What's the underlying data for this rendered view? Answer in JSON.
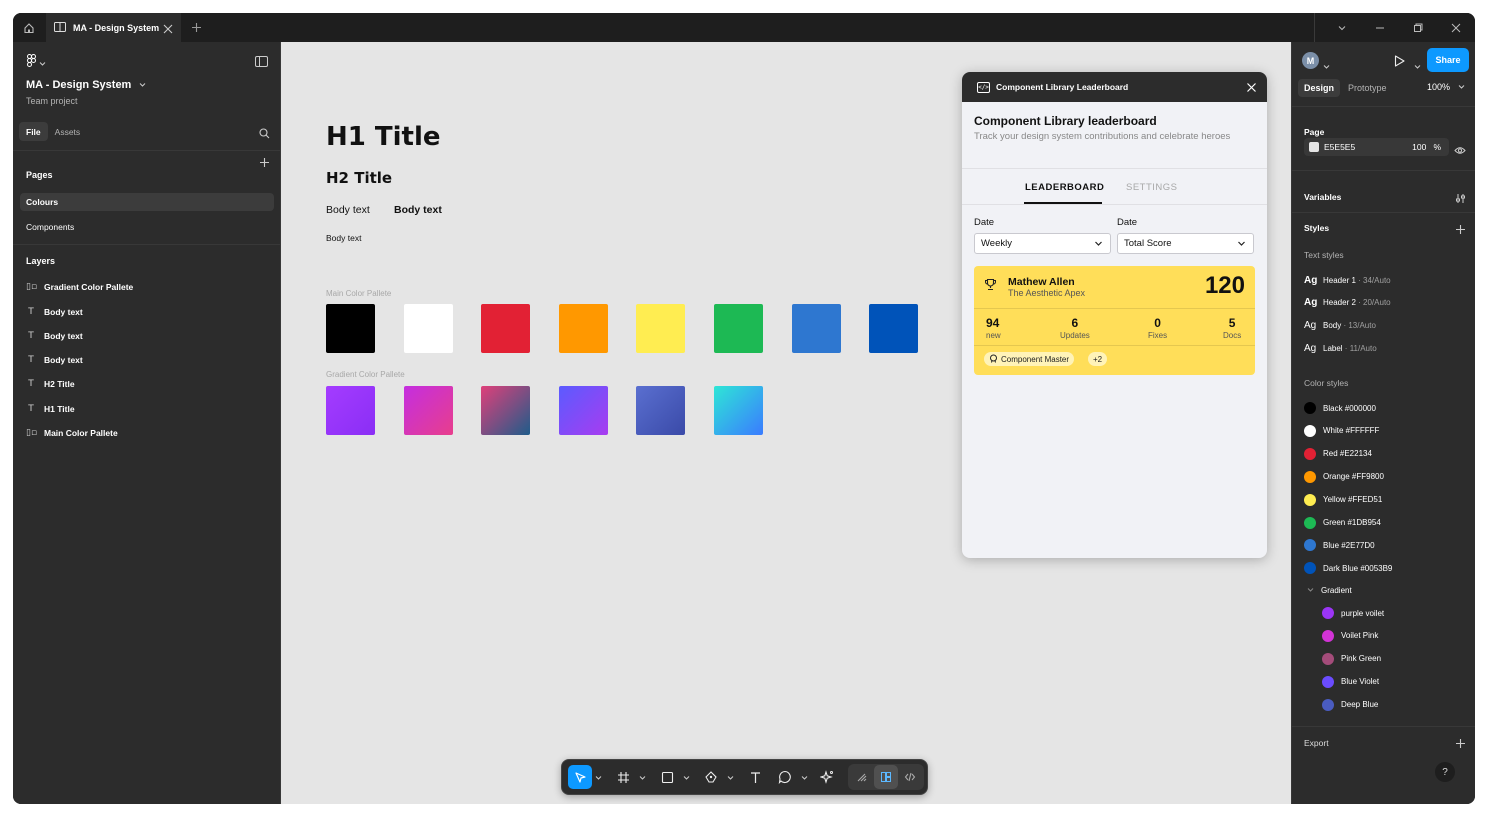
{
  "tab": {
    "title": "MA - Design System"
  },
  "file": {
    "title": "MA - Design System",
    "subtitle": "Team project",
    "tabs": [
      "File",
      "Assets"
    ]
  },
  "pages": {
    "heading": "Pages",
    "items": [
      {
        "label": "Colours",
        "active": true
      },
      {
        "label": "Components",
        "active": false
      }
    ]
  },
  "layers": {
    "heading": "Layers",
    "items": [
      {
        "icon": "frame-icon",
        "label": "Gradient Color Pallete"
      },
      {
        "icon": "text-icon",
        "label": "Body text"
      },
      {
        "icon": "text-icon",
        "label": "Body text"
      },
      {
        "icon": "text-icon",
        "label": "Body text"
      },
      {
        "icon": "text-icon",
        "label": "H2 Title"
      },
      {
        "icon": "text-icon",
        "label": "H1 Title"
      },
      {
        "icon": "frame-icon",
        "label": "Main Color Pallete"
      }
    ]
  },
  "canvas": {
    "h1": "H1 Title",
    "h2": "H2 Title",
    "body1": "Body text",
    "body2": "Body text",
    "body3": "Body text",
    "main_palette_label": "Main Color Pallete",
    "gradient_palette_label": "Gradient Color Pallete",
    "main_colors": [
      "#000000",
      "#FFFFFF",
      "#E22134",
      "#FF9800",
      "#FFED51",
      "#1DB954",
      "#2E77D0",
      "#0053B9"
    ],
    "gradients": [
      [
        "#a43cff",
        "#8a2ef5"
      ],
      [
        "#c42ee0",
        "#e83e8c"
      ],
      [
        "#e0407a",
        "#1f5c8a"
      ],
      [
        "#5b5bff",
        "#a83cf0"
      ],
      [
        "#5a6fd0",
        "#3a4aa8"
      ],
      [
        "#2ee6d6",
        "#3a7bff"
      ]
    ]
  },
  "plugin": {
    "window_title": "Component Library Leaderboard",
    "title": "Component Library leaderboard",
    "subtitle": "Track your design system contributions and celebrate heroes",
    "tabs": [
      "LEADERBOARD",
      "SETTINGS"
    ],
    "filters": [
      {
        "label": "Date",
        "value": "Weekly"
      },
      {
        "label": "Date",
        "value": "Total Score"
      }
    ],
    "card": {
      "name": "Mathew Allen",
      "team": "The Aesthetic Apex",
      "score": "120",
      "stats": [
        {
          "value": "94",
          "label": "new"
        },
        {
          "value": "6",
          "label": "Updates"
        },
        {
          "value": "0",
          "label": "Fixes"
        },
        {
          "value": "5",
          "label": "Docs"
        }
      ],
      "badge": "Component Master",
      "more": "+2"
    }
  },
  "right": {
    "avatar": "M",
    "share": "Share",
    "tabs": [
      "Design",
      "Prototype"
    ],
    "zoom": "100%",
    "page_heading": "Page",
    "page_fill": "E5E5E5",
    "page_opacity": "100",
    "page_pct": "%",
    "variables": "Variables",
    "styles": "Styles",
    "text_styles_heading": "Text styles",
    "text_styles": [
      {
        "ag": "Ag",
        "name": "Header 1",
        "meta": " · 34/Auto"
      },
      {
        "ag": "Ag",
        "name": "Header 2",
        "meta": " · 20/Auto"
      },
      {
        "ag": "Ag",
        "name": "Body",
        "meta": " · 13/Auto"
      },
      {
        "ag": "Ag",
        "name": "Label",
        "meta": " · 11/Auto"
      }
    ],
    "color_styles_heading": "Color styles",
    "color_styles": [
      {
        "name": "Black #000000",
        "color": "#000000"
      },
      {
        "name": "White #FFFFFF",
        "color": "#FFFFFF"
      },
      {
        "name": "Red #E22134",
        "color": "#E22134"
      },
      {
        "name": "Orange #FF9800",
        "color": "#FF9800"
      },
      {
        "name": "Yellow #FFED51",
        "color": "#FFED51"
      },
      {
        "name": "Green #1DB954",
        "color": "#1DB954"
      },
      {
        "name": "Blue #2E77D0",
        "color": "#2E77D0"
      },
      {
        "name": "Dark Blue #0053B9",
        "color": "#0053B9"
      }
    ],
    "gradient_group": "Gradient",
    "gradient_styles": [
      {
        "name": "purple voilet",
        "color": "#9b35f5"
      },
      {
        "name": "Voilet Pink",
        "color": "#d233d6"
      },
      {
        "name": "Pink Green",
        "color": "#a44c7a"
      },
      {
        "name": "Blue Violet",
        "color": "#6b4cff"
      },
      {
        "name": "Deep Blue",
        "color": "#4a5cc0"
      }
    ],
    "export": "Export",
    "help": "?"
  }
}
